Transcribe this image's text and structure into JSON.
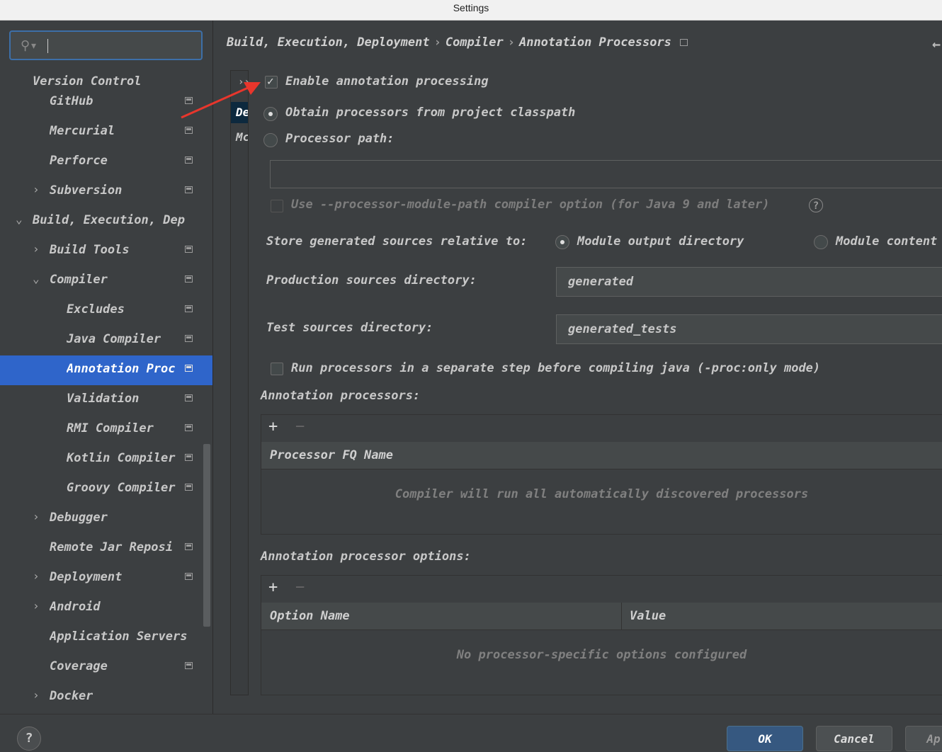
{
  "window": {
    "title": "Settings"
  },
  "search": {
    "value": ""
  },
  "sidebar": {
    "items": [
      {
        "label": "Version Control"
      },
      {
        "label": "GitHub"
      },
      {
        "label": "Mercurial"
      },
      {
        "label": "Perforce"
      },
      {
        "label": "Subversion"
      },
      {
        "label": "Build, Execution, Dep"
      },
      {
        "label": "Build Tools"
      },
      {
        "label": "Compiler"
      },
      {
        "label": "Excludes"
      },
      {
        "label": "Java Compiler"
      },
      {
        "label": "Annotation Proc"
      },
      {
        "label": "Validation"
      },
      {
        "label": "RMI Compiler"
      },
      {
        "label": "Kotlin Compiler"
      },
      {
        "label": "Groovy Compiler"
      },
      {
        "label": "Debugger"
      },
      {
        "label": "Remote Jar Reposi"
      },
      {
        "label": "Deployment"
      },
      {
        "label": "Android"
      },
      {
        "label": "Application Servers"
      },
      {
        "label": "Coverage"
      },
      {
        "label": "Docker"
      }
    ]
  },
  "breadcrumb": {
    "part1": "Build, Execution, Deployment",
    "part2": "Compiler",
    "part3": "Annotation Processors",
    "sep": "›"
  },
  "profiles": {
    "chevron": "››",
    "item1": "De",
    "item2": "Mc"
  },
  "options": {
    "enable_label": "Enable annotation processing",
    "enable_checked": true,
    "classpath_label": "Obtain processors from project classpath",
    "processor_path_label": "Processor path:",
    "processor_path_value": "",
    "module_path_label": "Use --processor-module-path compiler option (for Java 9 and later)",
    "store_label": "Store generated sources relative to:",
    "module_output_label": "Module output directory",
    "module_content_label": "Module content",
    "prod_dir_label": "Production sources directory:",
    "prod_dir_value": "generated",
    "test_dir_label": "Test sources directory:",
    "test_dir_value": "generated_tests",
    "run_separate_label": "Run processors in a separate step before compiling java (-proc:only mode)"
  },
  "processors_panel": {
    "title": "Annotation processors:",
    "column": "Processor FQ Name",
    "empty": "Compiler will run all automatically discovered processors"
  },
  "options_panel": {
    "title": "Annotation processor options:",
    "col_name": "Option Name",
    "col_value": "Value",
    "empty": "No processor-specific options configured"
  },
  "buttons": {
    "ok": "OK",
    "cancel": "Cancel",
    "apply": "Ap",
    "help": "?"
  }
}
